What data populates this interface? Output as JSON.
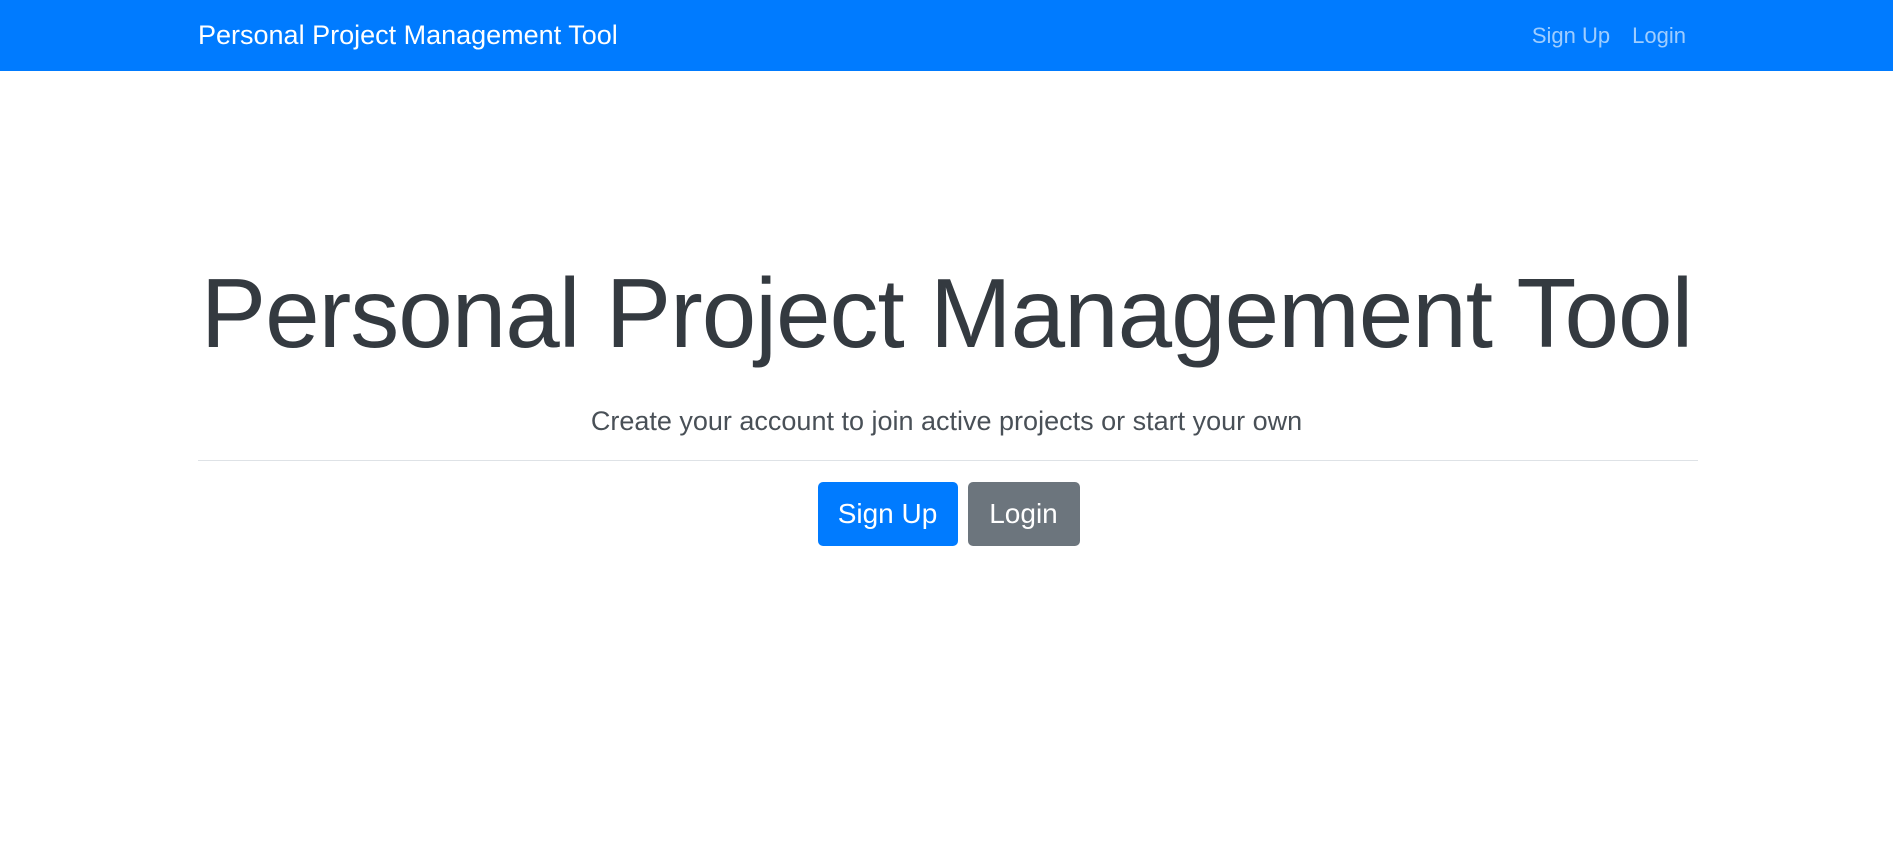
{
  "navbar": {
    "brand": "Personal Project Management Tool",
    "links": [
      {
        "label": "Sign Up"
      },
      {
        "label": "Login"
      }
    ],
    "background_color": "#007bff"
  },
  "hero": {
    "title": "Personal Project Management Tool",
    "lead": "Create your account to join active projects or start your own",
    "buttons": {
      "signup_label": "Sign Up",
      "login_label": "Login"
    },
    "colors": {
      "primary": "#007bff",
      "secondary": "#6c757d",
      "title_text": "#343a40"
    }
  }
}
